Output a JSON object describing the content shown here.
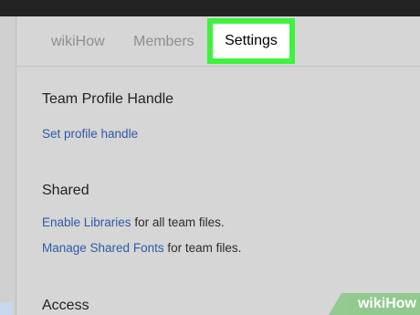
{
  "tabs": {
    "wikihow": "wikiHow",
    "members": "Members",
    "settings": "Settings"
  },
  "profile": {
    "title": "Team Profile Handle",
    "link": "Set profile handle"
  },
  "shared": {
    "title": "Shared",
    "libraries_link": "Enable Libraries",
    "libraries_suffix": " for all team files.",
    "fonts_link": "Manage Shared Fonts",
    "fonts_suffix": " for team files."
  },
  "access": {
    "title": "Access"
  },
  "watermark": {
    "part1": "wiki",
    "part2": "How"
  },
  "colors": {
    "highlight": "#3ef33e",
    "link": "#2f59a7"
  }
}
